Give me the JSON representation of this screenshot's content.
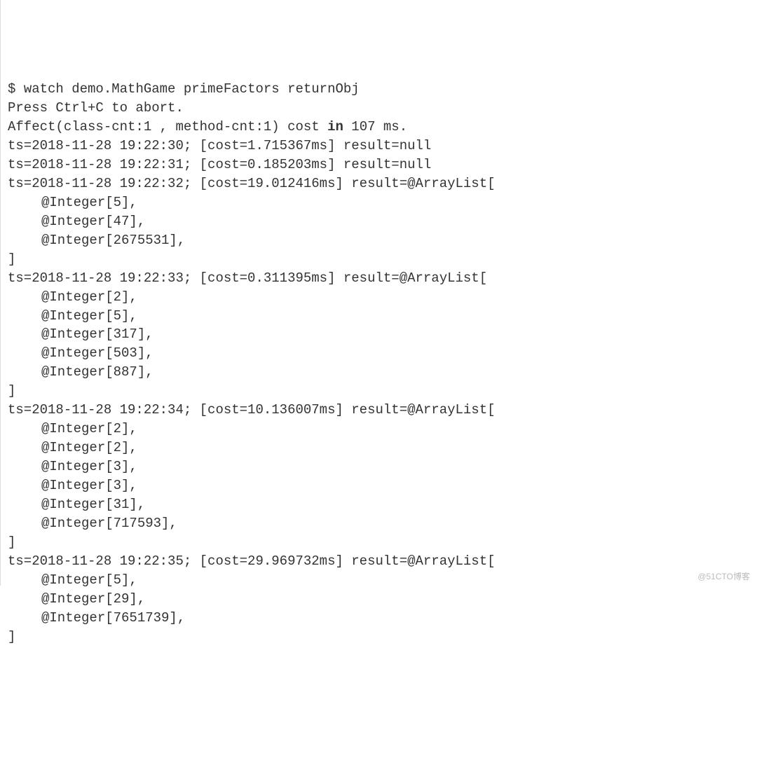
{
  "terminal": {
    "prompt": "$ ",
    "command": "watch demo.MathGame primeFactors returnObj",
    "abort_hint": "Press Ctrl+C to abort.",
    "affect_prefix": "Affect(class-cnt:1 , method-cnt:1) cost ",
    "affect_bold": "in",
    "affect_suffix": " 107 ms.",
    "entries": [
      {
        "ts": "2018-11-28 19:22:30",
        "cost": "1.715367ms",
        "result_type": "null",
        "result_text": "result=null"
      },
      {
        "ts": "2018-11-28 19:22:31",
        "cost": "0.185203ms",
        "result_type": "null",
        "result_text": "result=null"
      },
      {
        "ts": "2018-11-28 19:22:32",
        "cost": "19.012416ms",
        "result_type": "ArrayList",
        "result_text": "result=@ArrayList[",
        "items": [
          "@Integer[5],",
          "@Integer[47],",
          "@Integer[2675531],"
        ]
      },
      {
        "ts": "2018-11-28 19:22:33",
        "cost": "0.311395ms",
        "result_type": "ArrayList",
        "result_text": "result=@ArrayList[",
        "items": [
          "@Integer[2],",
          "@Integer[5],",
          "@Integer[317],",
          "@Integer[503],",
          "@Integer[887],"
        ]
      },
      {
        "ts": "2018-11-28 19:22:34",
        "cost": "10.136007ms",
        "result_type": "ArrayList",
        "result_text": "result=@ArrayList[",
        "items": [
          "@Integer[2],",
          "@Integer[2],",
          "@Integer[3],",
          "@Integer[3],",
          "@Integer[31],",
          "@Integer[717593],"
        ]
      },
      {
        "ts": "2018-11-28 19:22:35",
        "cost": "29.969732ms",
        "result_type": "ArrayList",
        "result_text": "result=@ArrayList[",
        "items": [
          "@Integer[5],",
          "@Integer[29],",
          "@Integer[7651739],"
        ]
      }
    ],
    "close_bracket": "]"
  },
  "watermark": "@51CTO博客"
}
